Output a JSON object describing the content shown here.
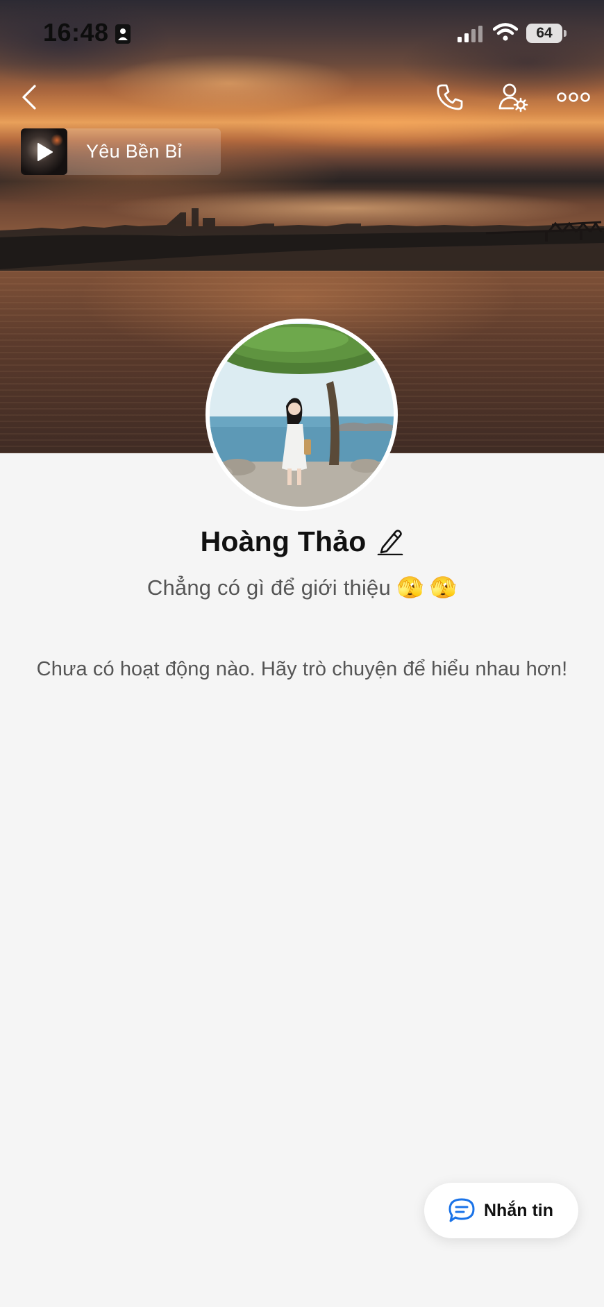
{
  "status_bar": {
    "time": "16:48",
    "battery": "64"
  },
  "nav": {
    "back_icon": "chevron-left-icon",
    "call_icon": "phone-icon",
    "user_settings_icon": "user-gear-icon",
    "more_icon": "ellipsis-icon"
  },
  "music": {
    "title": "Yêu Bền Bỉ",
    "play_icon": "play-icon"
  },
  "profile": {
    "name": "Hoàng Thảo",
    "bio": "Chẳng có gì để giới thiệu 🫣 🫣",
    "edit_icon": "pencil-icon"
  },
  "activity": {
    "empty_text": "Chưa có hoạt động nào. Hãy trò chuyện để hiểu nhau hơn!"
  },
  "message_button": {
    "label": "Nhắn tin",
    "icon": "chat-bubble-icon"
  },
  "colors": {
    "background": "#f5f5f5",
    "accent": "#1a73e8",
    "text_primary": "#111111",
    "text_secondary": "#555555"
  }
}
